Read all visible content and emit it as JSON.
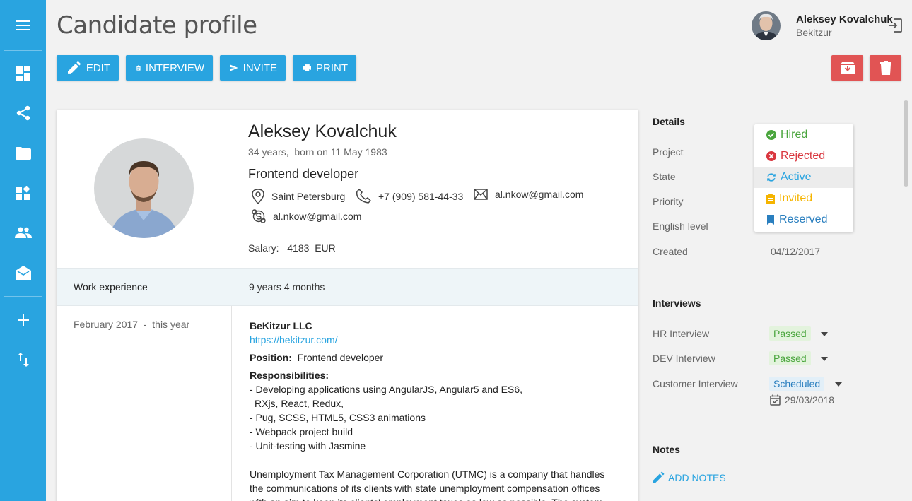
{
  "sidebar": {
    "items": [
      {
        "icon": "menu-icon"
      },
      {
        "icon": "dashboard-icon"
      },
      {
        "icon": "share-icon"
      },
      {
        "icon": "folder-icon"
      },
      {
        "icon": "widgets-icon"
      },
      {
        "icon": "people-icon"
      },
      {
        "icon": "mail-open-icon"
      },
      {
        "icon": "add-icon"
      },
      {
        "icon": "swap-vert-icon"
      }
    ],
    "color": "#29a4e0"
  },
  "header": {
    "title": "Candidate profile",
    "user_name": "Aleksey Kovalchuk",
    "user_company": "Bekitzur"
  },
  "toolbar": {
    "edit": "EDIT",
    "interview": "INTERVIEW",
    "invite": "INVITE",
    "print": "PRINT"
  },
  "candidate": {
    "name": "Aleksey Kovalchuk",
    "age": "34 years,",
    "born": "born on 11 May 1983",
    "position": "Frontend developer",
    "city": "Saint Petersburg",
    "phone": "+7 (909) 581-44-33",
    "email": "al.nkow@gmail.com",
    "skype": "al.nkow@gmail.com",
    "salary_label": "Salary:",
    "salary_value": "4183",
    "salary_currency": "EUR"
  },
  "experience": {
    "label": "Work experience",
    "total": "9 years 4 months",
    "jobs": [
      {
        "period": "February 2017  -  this year",
        "company": "BeKitzur LLC",
        "url": "https://bekitzur.com/",
        "position_label": "Position:",
        "position": "Frontend developer",
        "resp_label": "Responsibilities:",
        "resp": [
          "- Developing applications using AngularJS, Angular5 and ES6,",
          "RXjs, React, Redux,",
          "- Pug, SCSS, HTML5, CSS3 animations",
          "- Webpack project build",
          "- Unit-testing with Jasmine"
        ],
        "desc": [
          "Unemployment Tax Management Corporation (UTMC) is a company that handles",
          "the communications of its clients with state unemployment compensation offices",
          "with an aim to keep its clients' employment taxes as low as possible. The system"
        ]
      }
    ]
  },
  "details": {
    "title": "Details",
    "project_label": "Project",
    "state_label": "State",
    "priority_label": "Priority",
    "english_label": "English level",
    "created_label": "Created",
    "created_value": "04/12/2017"
  },
  "state_dropdown": {
    "options": [
      {
        "label": "Hired",
        "color": "#4aa53d",
        "icon": "check-circle-icon"
      },
      {
        "label": "Rejected",
        "color": "#d9363e",
        "icon": "cancel-circle-icon"
      },
      {
        "label": "Active",
        "color": "#29a4e0",
        "icon": "refresh-icon"
      },
      {
        "label": "Invited",
        "color": "#f5b400",
        "icon": "clipboard-icon"
      },
      {
        "label": "Reserved",
        "color": "#2a7fbf",
        "icon": "bookmark-icon"
      }
    ],
    "selected": "Active"
  },
  "interviews": {
    "title": "Interviews",
    "items": [
      {
        "label": "HR Interview",
        "status": "Passed"
      },
      {
        "label": "DEV Interview",
        "status": "Passed"
      },
      {
        "label": "Customer Interview",
        "status": "Scheduled",
        "date": "29/03/2018"
      }
    ]
  },
  "notes": {
    "title": "Notes",
    "add_label": "ADD NOTES"
  }
}
